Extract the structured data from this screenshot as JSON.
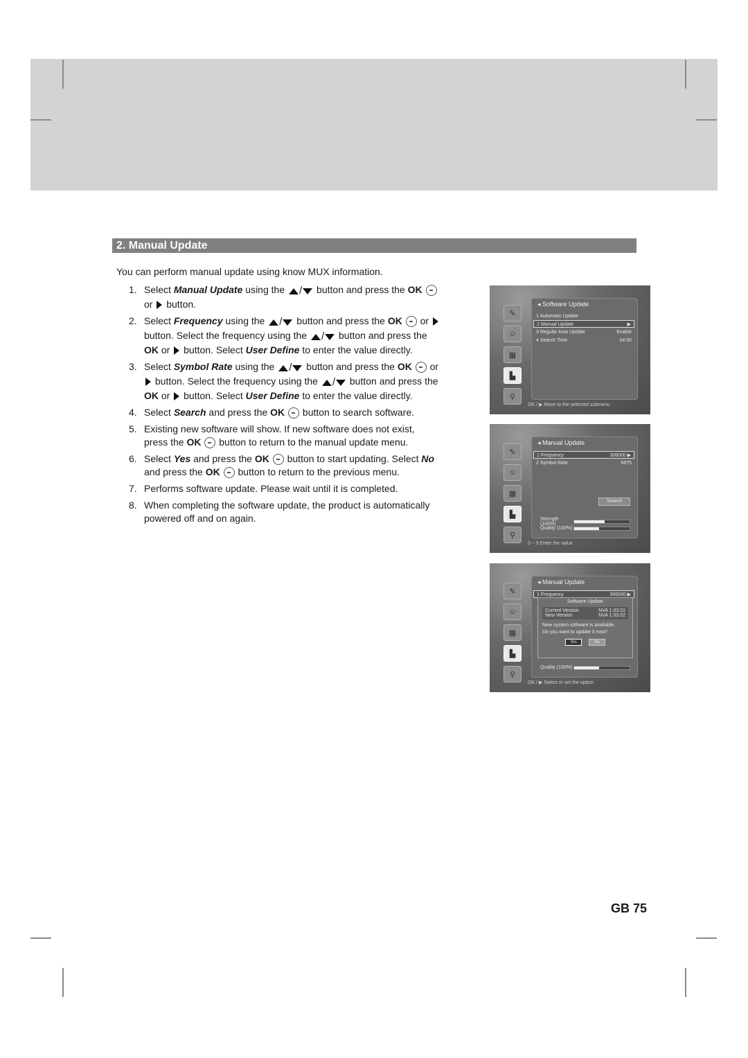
{
  "section": {
    "title": "2. Manual Update",
    "intro": "You can perform manual update using know MUX information."
  },
  "steps": [
    {
      "num": "1.",
      "parts": [
        {
          "t": "Select "
        },
        {
          "em": "Manual Update"
        },
        {
          "t": " using the "
        },
        {
          "icon": "updown"
        },
        {
          "t": " button and press the "
        },
        {
          "b": "OK"
        },
        {
          "t": " "
        },
        {
          "icon": "ok"
        },
        {
          "t": " or "
        },
        {
          "icon": "right"
        },
        {
          "t": " button."
        }
      ]
    },
    {
      "num": "2.",
      "parts": [
        {
          "t": "Select "
        },
        {
          "em": "Frequency"
        },
        {
          "t": " using the "
        },
        {
          "icon": "updown"
        },
        {
          "t": " button and press the "
        },
        {
          "b": "OK"
        },
        {
          "t": " "
        },
        {
          "icon": "ok"
        },
        {
          "t": " or "
        },
        {
          "icon": "right"
        },
        {
          "t": " button. Select the frequency using the "
        },
        {
          "icon": "updown"
        },
        {
          "t": " button and press the "
        },
        {
          "b": "OK"
        },
        {
          "t": " or "
        },
        {
          "icon": "right"
        },
        {
          "t": " button. Select "
        },
        {
          "em": "User Define"
        },
        {
          "t": " to enter the value directly."
        }
      ]
    },
    {
      "num": "3.",
      "parts": [
        {
          "t": "Select "
        },
        {
          "em": "Symbol Rate"
        },
        {
          "t": " using the "
        },
        {
          "icon": "updown"
        },
        {
          "t": " button and press the "
        },
        {
          "b": "OK"
        },
        {
          "t": " "
        },
        {
          "icon": "ok"
        },
        {
          "t": " or "
        },
        {
          "icon": "right"
        },
        {
          "t": " button. Select the frequency using the "
        },
        {
          "icon": "updown"
        },
        {
          "t": " button and press the "
        },
        {
          "b": "OK"
        },
        {
          "t": " or "
        },
        {
          "icon": "right"
        },
        {
          "t": " button. Select "
        },
        {
          "em": "User Define"
        },
        {
          "t": " to enter the value directly."
        }
      ]
    },
    {
      "num": "4.",
      "parts": [
        {
          "t": "Select "
        },
        {
          "em": "Search"
        },
        {
          "t": " and press the "
        },
        {
          "b": "OK"
        },
        {
          "t": " "
        },
        {
          "icon": "ok"
        },
        {
          "t": " button to search software."
        }
      ]
    },
    {
      "num": "5.",
      "parts": [
        {
          "t": "Existing new software will show. If new software does not exist, press the "
        },
        {
          "b": "OK"
        },
        {
          "t": " "
        },
        {
          "icon": "ok"
        },
        {
          "t": " button to return to the manual update menu."
        }
      ]
    },
    {
      "num": "6.",
      "parts": [
        {
          "t": "Select "
        },
        {
          "em": "Yes"
        },
        {
          "t": " and press the "
        },
        {
          "b": "OK"
        },
        {
          "t": " "
        },
        {
          "icon": "ok"
        },
        {
          "t": " button to start updating. Select "
        },
        {
          "em": "No"
        },
        {
          "t": " and press the "
        },
        {
          "b": "OK"
        },
        {
          "t": " "
        },
        {
          "icon": "ok"
        },
        {
          "t": " button to return to the previous menu."
        }
      ]
    },
    {
      "num": "7.",
      "parts": [
        {
          "t": "Performs software update. Please wait until it is completed."
        }
      ]
    },
    {
      "num": "8.",
      "parts": [
        {
          "t": "When completing the software update, the product is automatically powered off and on again."
        }
      ]
    }
  ],
  "screens": {
    "software_update": {
      "title": "Software Update",
      "rows": [
        {
          "label": "1  Automatic Update",
          "value": ""
        },
        {
          "label": "2  Manual Update",
          "value": "▶",
          "selected": true
        },
        {
          "label": "3  Regular Auto Update",
          "value": "Enable"
        },
        {
          "label": "4  Search Time",
          "value": "04:00"
        }
      ],
      "footer": "OK / ▶ Move to the selected submenu"
    },
    "manual_update": {
      "title": "Manual Update",
      "rows": [
        {
          "label": "1  Frequency",
          "value": "306000 ▶",
          "selected": true
        },
        {
          "label": "2  Symbol Rate",
          "value": "6875"
        }
      ],
      "search_label": "Search",
      "strength_label": "Strength (100%)",
      "strength_fill": 0.55,
      "quality_label": "Quality (100%)",
      "quality_fill": 0.45,
      "footer": "0 ~ 9 Enter the value"
    },
    "update_dialog": {
      "title": "Manual Update",
      "row": {
        "label": "1  Frequency",
        "value": "306000 ▶"
      },
      "dialog_title": "Software Update",
      "current_label": "Current Version",
      "current_value": "NVA 1.03.01",
      "new_label": "New Version",
      "new_value": "NVA 1.03.02",
      "message_1": "New system software is available.",
      "message_2": "Do you want to update it now?",
      "yes_label": "Yes",
      "no_label": "No",
      "quality_label": "Quality (100%)",
      "quality_fill": 0.45,
      "footer": "OK / ▶ Select or set the option"
    }
  },
  "page_number": "GB 75"
}
